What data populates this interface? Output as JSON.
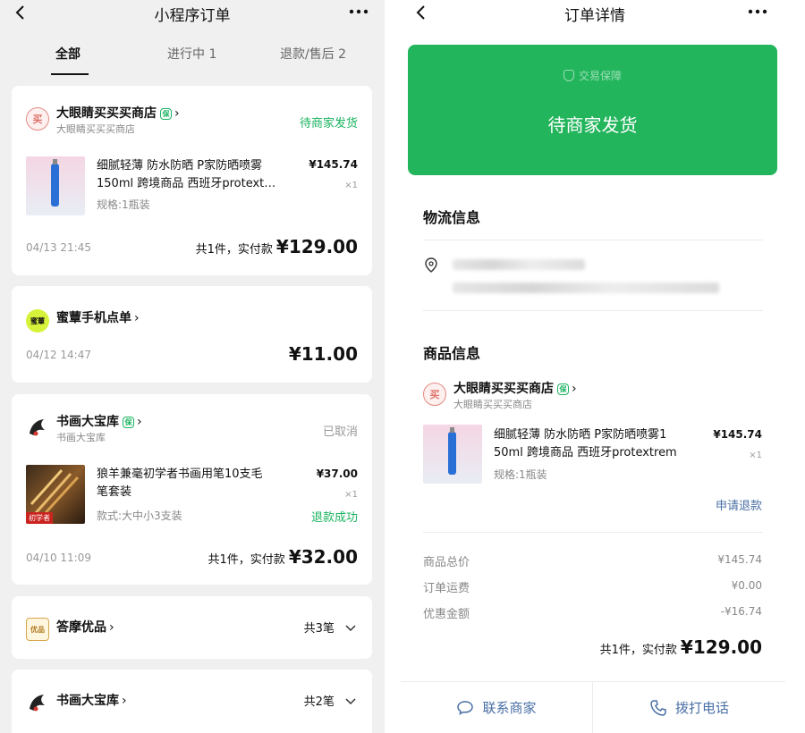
{
  "left": {
    "title": "小程序订单",
    "tabs": [
      {
        "label": "全部"
      },
      {
        "label": "进行中 1"
      },
      {
        "label": "退款/售后 2"
      }
    ],
    "orders": [
      {
        "shop_name": "大眼睛买买买商店",
        "shop_sub": "大眼睛买买买商店",
        "logo_text": "买",
        "status": "待商家发货",
        "item_title_1": "细腻轻薄 防水防晒 P家防晒喷雾",
        "item_title_2": "150ml 跨境商品 西班牙protext…",
        "item_spec": "规格:1瓶装",
        "item_price": "¥145.74",
        "item_qty": "×1",
        "date": "04/13 21:45",
        "total_label": "共1件，实付款",
        "total_value": "¥129.00"
      },
      {
        "shop_name": "蜜蕈手机点单",
        "logo_text": "蜜蕈",
        "date": "04/12 14:47",
        "total_value": "¥11.00"
      },
      {
        "shop_name": "书画大宝库",
        "shop_sub": "书画大宝库",
        "status": "已取消",
        "item_title_1": "狼羊兼毫初学者书画用笔10支毛",
        "item_title_2": "笔套装",
        "item_spec": "款式:大中小3支装",
        "item_price": "¥37.00",
        "item_qty": "×1",
        "refund": "退款成功",
        "thumb_text": "初学者",
        "date": "04/10 11:09",
        "total_label": "共1件，实付款",
        "total_value": "¥32.00"
      },
      {
        "shop_name": "答摩优品",
        "logo_text": "优品",
        "count": "共3笔"
      },
      {
        "shop_name": "书画大宝库",
        "count": "共2笔"
      }
    ]
  },
  "right": {
    "title": "订单详情",
    "guarantee": "交易保障",
    "status": "待商家发货",
    "logistics_title": "物流信息",
    "goods_title": "商品信息",
    "shop_name": "大眼睛买买买商店",
    "shop_sub": "大眼睛买买买商店",
    "logo_text": "买",
    "item_title_1": "细腻轻薄 防水防晒 P家防晒喷雾1",
    "item_title_2": "50ml 跨境商品 西班牙protextrem",
    "item_spec": "规格:1瓶装",
    "item_price": "¥145.74",
    "item_qty": "×1",
    "refund_button": "申请退款",
    "fees": [
      {
        "label": "商品总价",
        "value": "¥145.74"
      },
      {
        "label": "订单运费",
        "value": "¥0.00"
      },
      {
        "label": "优惠金额",
        "value": "-¥16.74"
      }
    ],
    "total_label": "共1件，实付款",
    "total_value": "¥129.00",
    "contact_button": "联系商家",
    "call_button": "拨打电话"
  },
  "colors": {
    "green": "#22b55c",
    "status_green": "#19b35f",
    "link_blue": "#4a6fa5"
  }
}
